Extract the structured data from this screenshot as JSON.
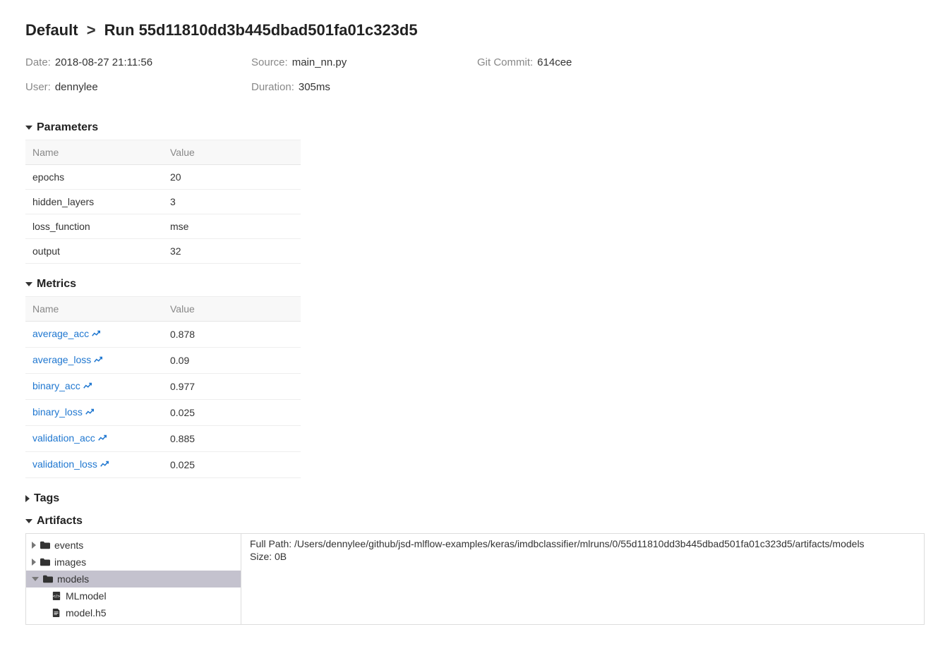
{
  "breadcrumb": {
    "root": "Default",
    "run_prefix": "Run",
    "run_id": "55d11810dd3b445dbad501fa01c323d5"
  },
  "meta": {
    "date_label": "Date:",
    "date_value": "2018-08-27 21:11:56",
    "source_label": "Source:",
    "source_value": "main_nn.py",
    "git_label": "Git Commit:",
    "git_value": "614cee",
    "user_label": "User:",
    "user_value": "dennylee",
    "duration_label": "Duration:",
    "duration_value": "305ms"
  },
  "sections": {
    "parameters": "Parameters",
    "metrics": "Metrics",
    "tags": "Tags",
    "artifacts": "Artifacts"
  },
  "table_headers": {
    "name": "Name",
    "value": "Value"
  },
  "parameters": [
    {
      "name": "epochs",
      "value": "20"
    },
    {
      "name": "hidden_layers",
      "value": "3"
    },
    {
      "name": "loss_function",
      "value": "mse"
    },
    {
      "name": "output",
      "value": "32"
    }
  ],
  "metrics": [
    {
      "name": "average_acc",
      "value": "0.878"
    },
    {
      "name": "average_loss",
      "value": "0.09"
    },
    {
      "name": "binary_acc",
      "value": "0.977"
    },
    {
      "name": "binary_loss",
      "value": "0.025"
    },
    {
      "name": "validation_acc",
      "value": "0.885"
    },
    {
      "name": "validation_loss",
      "value": "0.025"
    }
  ],
  "artifacts": {
    "tree": [
      {
        "type": "folder",
        "name": "events",
        "expanded": false,
        "selected": false,
        "depth": 0
      },
      {
        "type": "folder",
        "name": "images",
        "expanded": false,
        "selected": false,
        "depth": 0
      },
      {
        "type": "folder",
        "name": "models",
        "expanded": true,
        "selected": true,
        "depth": 0
      },
      {
        "type": "file",
        "name": "MLmodel",
        "icon": "code",
        "depth": 1
      },
      {
        "type": "file",
        "name": "model.h5",
        "icon": "doc",
        "depth": 1
      }
    ],
    "details": {
      "full_path_label": "Full Path:",
      "full_path_value": "/Users/dennylee/github/jsd-mlflow-examples/keras/imdbclassifier/mlruns/0/55d11810dd3b445dbad501fa01c323d5/artifacts/models",
      "size_label": "Size:",
      "size_value": "0B"
    }
  }
}
